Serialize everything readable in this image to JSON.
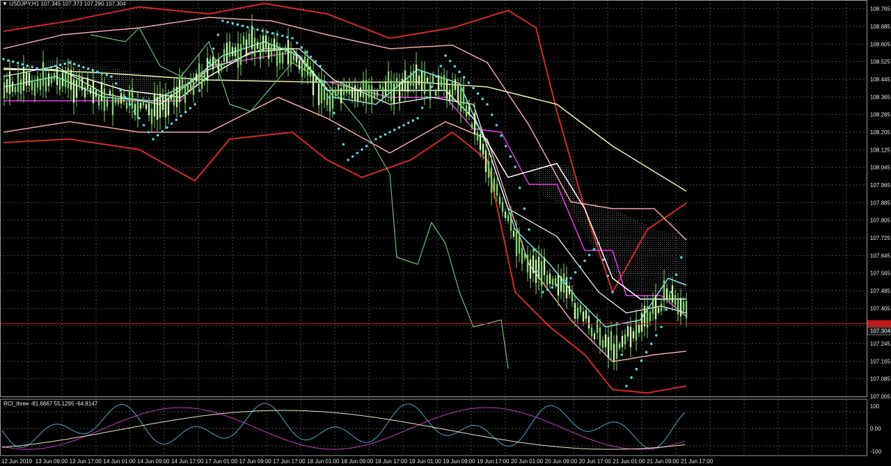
{
  "window": {
    "symbol_header": "USDJPY,H1",
    "ohlc": "107.345 107.373 107.290 107.304",
    "menu_glyph": "▼"
  },
  "indicator": {
    "header": "RCI_three -81.6667 55.1295 -64.8147"
  },
  "colors": {
    "background": "#000000",
    "grid": "#6b6b6b",
    "candle_up": "#c9f5a8",
    "candle_down": "#7fd36a",
    "bb_outer": "#d42a2a",
    "bb_mid": "#f3a8a8",
    "bb_inner": "#ffd0d0",
    "ma_slow": "#f2f2b0",
    "sar": "#5fd3e0",
    "ichimoku_kijun": "#e040e0",
    "ichimoku_tenkan": "#ffffff",
    "chikou": "#6fbf73",
    "cyan_line": "#7fe6f0",
    "bid_line": "#c01818",
    "rci_short": "#4fa8c8",
    "rci_mid": "#c040c0",
    "rci_long": "#e8e8c0"
  },
  "price_axis": {
    "ticks": [
      "108.765",
      "108.685",
      "108.605",
      "108.525",
      "108.445",
      "108.365",
      "108.285",
      "108.205",
      "108.125",
      "108.045",
      "107.965",
      "107.885",
      "107.805",
      "107.725",
      "107.645",
      "107.565",
      "107.485",
      "107.405",
      "107.325",
      "107.245",
      "107.165",
      "107.085",
      "107.005"
    ],
    "current_price": "107.304",
    "current_price_box_color": "#c01818"
  },
  "indicator_axis": {
    "ticks": [
      "100",
      "0.00",
      "-100"
    ],
    "extra": "1.00"
  },
  "time_axis": {
    "labels": [
      "12 Jun 2019",
      "13 Jun 09:00",
      "13 Jun 17:00",
      "14 Jun 01:00",
      "14 Jun 09:00",
      "14 Jun 17:00",
      "17 Jun 01:00",
      "17 Jun 09:00",
      "17 Jun 17:00",
      "18 Jun 01:00",
      "18 Jun 09:00",
      "18 Jun 17:00",
      "19 Jun 01:00",
      "19 Jun 09:00",
      "19 Jun 17:00",
      "20 Jun 01:00",
      "20 Jun 09:00",
      "20 Jun 17:00",
      "21 Jun 01:00",
      "21 Jun 09:00",
      "21 Jun 17:00"
    ]
  }
}
